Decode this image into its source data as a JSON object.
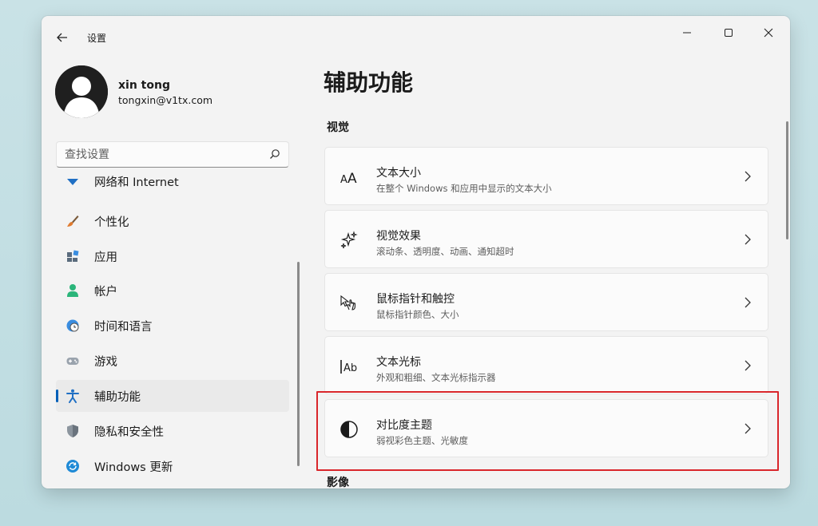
{
  "titlebar": {
    "back_icon": "back-arrow-icon",
    "title": "设置"
  },
  "profile": {
    "name": "xin tong",
    "email": "tongxin@v1tx.com"
  },
  "search": {
    "placeholder": "查找设置"
  },
  "nav": {
    "items": [
      {
        "label": "网络和 Internet",
        "icon": "wifi-icon"
      },
      {
        "label": "个性化",
        "icon": "brush-icon"
      },
      {
        "label": "应用",
        "icon": "apps-icon"
      },
      {
        "label": "帐户",
        "icon": "person-icon"
      },
      {
        "label": "时间和语言",
        "icon": "globe-clock-icon"
      },
      {
        "label": "游戏",
        "icon": "gamepad-icon"
      },
      {
        "label": "辅助功能",
        "icon": "accessibility-icon",
        "active": true
      },
      {
        "label": "隐私和安全性",
        "icon": "shield-icon"
      },
      {
        "label": "Windows 更新",
        "icon": "update-icon"
      }
    ]
  },
  "main": {
    "title": "辅助功能",
    "section_vision": "视觉",
    "section_image": "影像",
    "cards": [
      {
        "title": "文本大小",
        "desc": "在整个 Windows 和应用中显示的文本大小",
        "icon": "text-size-icon"
      },
      {
        "title": "视觉效果",
        "desc": "滚动条、透明度、动画、通知超时",
        "icon": "sparkle-icon"
      },
      {
        "title": "鼠标指针和触控",
        "desc": "鼠标指针颜色、大小",
        "icon": "pointer-hand-icon"
      },
      {
        "title": "文本光标",
        "desc": "外观和粗细、文本光标指示器",
        "icon": "text-cursor-icon"
      },
      {
        "title": "对比度主题",
        "desc": "弱视彩色主题、光敏度",
        "icon": "contrast-icon",
        "highlighted": true
      }
    ]
  },
  "colors": {
    "accent": "#005fb8",
    "highlight_border": "#d9262b"
  }
}
